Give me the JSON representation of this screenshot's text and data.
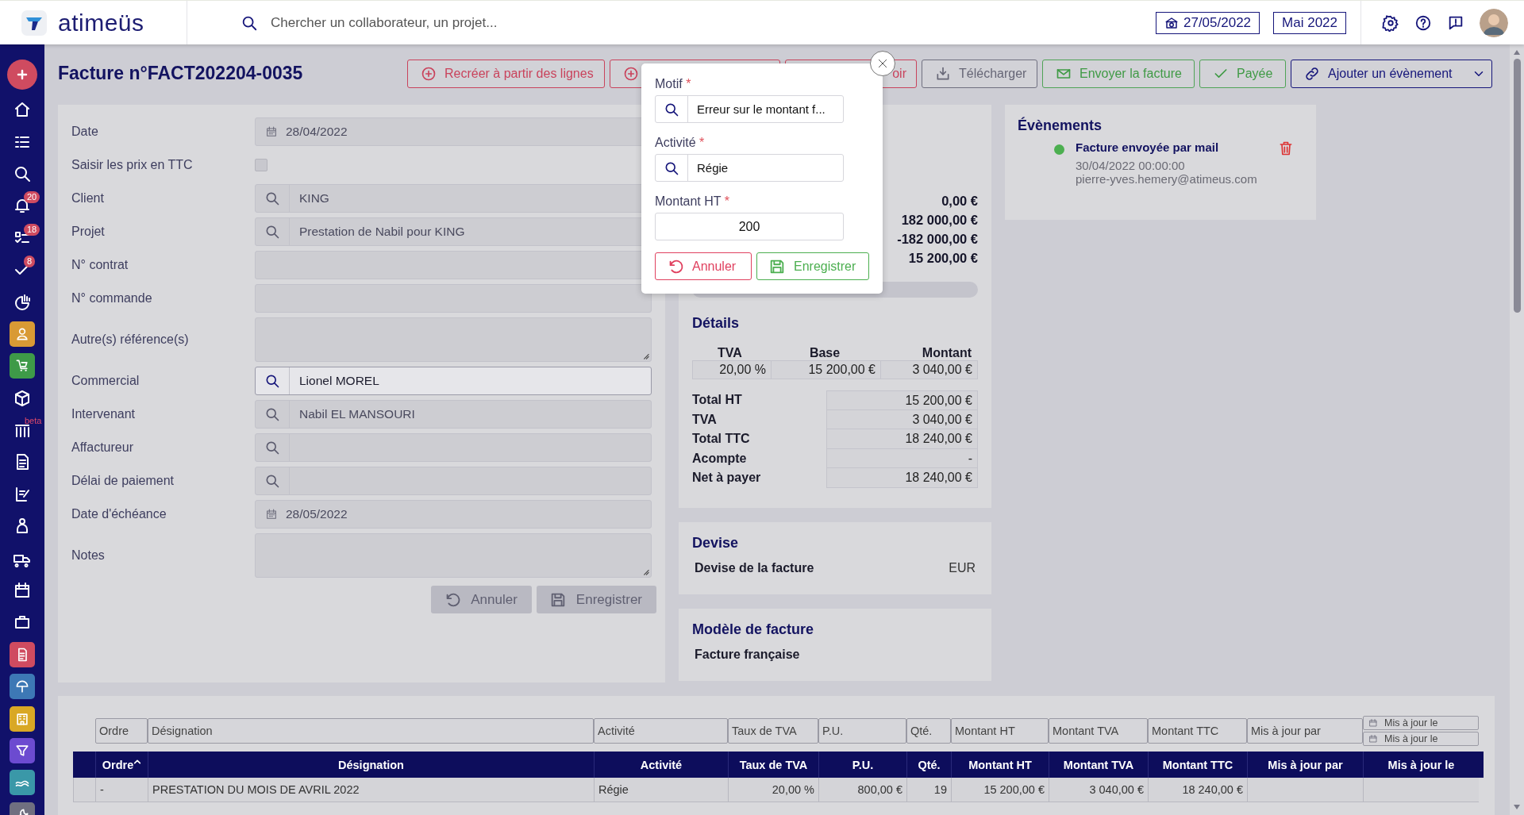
{
  "header": {
    "logo_text": "atimeüs",
    "search": {
      "placeholder": "Chercher un collaborateur, un projet..."
    },
    "date_button": "27/05/2022",
    "period_button": "Mai 2022"
  },
  "sidebar": {
    "items": [
      {
        "kind": "add"
      },
      {
        "kind": "plain"
      },
      {
        "kind": "plain"
      },
      {
        "kind": "plain"
      },
      {
        "kind": "plain",
        "badge": "20"
      },
      {
        "kind": "plain",
        "badge": "18"
      },
      {
        "kind": "plain",
        "badge": "8"
      },
      {
        "kind": "plain"
      },
      {
        "kind": "tile",
        "color": "#d99a35"
      },
      {
        "kind": "tile",
        "color": "#3e9a48"
      },
      {
        "kind": "plain"
      },
      {
        "kind": "plain",
        "tag": "beta"
      },
      {
        "kind": "plain"
      },
      {
        "kind": "plain"
      },
      {
        "kind": "plain"
      },
      {
        "kind": "plain"
      },
      {
        "kind": "plain"
      },
      {
        "kind": "plain"
      },
      {
        "kind": "tile",
        "color": "#cf4b60"
      },
      {
        "kind": "tile",
        "color": "#3d78b5"
      },
      {
        "kind": "tile",
        "color": "#d9a825"
      },
      {
        "kind": "tile",
        "color": "#6c4bd0"
      },
      {
        "kind": "tile",
        "color": "#3a98a8"
      },
      {
        "kind": "tile",
        "color": "#6f6f80"
      }
    ]
  },
  "page": {
    "title": "Facture n°FACT202204-0035"
  },
  "toolbar": [
    {
      "label": "Recréer à partir des lignes",
      "kind": "danger"
    },
    {
      "kind": "danger"
    },
    {
      "label": "oir",
      "kind": "danger"
    },
    {
      "label": "Télécharger",
      "kind": "neutral"
    },
    {
      "label": "Envoyer la facture",
      "kind": "success"
    },
    {
      "label": "Payée",
      "kind": "success"
    },
    {
      "label": "Ajouter un évènement",
      "kind": "primary"
    }
  ],
  "form": {
    "fields": [
      {
        "label": "Date",
        "kind": "date",
        "value": "28/04/2022",
        "disabled": true
      },
      {
        "label": "Saisir les prix en TTC",
        "kind": "checkbox",
        "checked": false,
        "disabled": true
      },
      {
        "label": "Client",
        "kind": "search",
        "value": "KING",
        "disabled": true
      },
      {
        "label": "Projet",
        "kind": "search",
        "value": "Prestation de Nabil pour KING",
        "disabled": true
      },
      {
        "label": "N° contrat",
        "kind": "text",
        "disabled": true
      },
      {
        "label": "N° commande",
        "kind": "text",
        "disabled": true
      },
      {
        "label": "Autre(s) référence(s)",
        "kind": "textarea",
        "disabled": true
      },
      {
        "label": "Commercial",
        "kind": "search",
        "value": "Lionel MOREL",
        "disabled": false
      },
      {
        "label": "Intervenant",
        "kind": "search",
        "value": "Nabil EL MANSOURI",
        "disabled": true
      },
      {
        "label": "Affactureur",
        "kind": "search",
        "disabled": true
      },
      {
        "label": "Délai de paiement",
        "kind": "search",
        "disabled": true
      },
      {
        "label": "Date d'échéance",
        "kind": "date",
        "value": "28/05/2022",
        "disabled": true
      },
      {
        "label": "Notes",
        "kind": "textarea",
        "disabled": true
      }
    ],
    "actions": [
      {
        "label": "Annuler",
        "kind": "cancel",
        "disabled": true
      },
      {
        "label": "Enregistrer",
        "kind": "save",
        "disabled": true
      }
    ]
  },
  "summary": {
    "amounts": [
      "0,00 €",
      "182 000,00 €",
      "-182 000,00 €",
      "15 200,00 €"
    ],
    "details": {
      "title": "Détails",
      "columns": [
        "TVA",
        "Base",
        "Montant"
      ],
      "rows": [
        [
          "20,00 %",
          "15 200,00 €",
          "3 040,00 €"
        ]
      ],
      "totals": [
        {
          "label": "Total HT",
          "value": "15 200,00 €"
        },
        {
          "label": "TVA",
          "value": "3 040,00 €"
        },
        {
          "label": "Total TTC",
          "value": "18 240,00 €"
        },
        {
          "label": "Acompte",
          "value": "-"
        },
        {
          "label": "Net à payer",
          "value": "18 240,00 €"
        }
      ]
    }
  },
  "currency": {
    "title": "Devise",
    "label": "Devise de la facture",
    "value": "EUR"
  },
  "template": {
    "title": "Modèle de facture",
    "value": "Facture française"
  },
  "events": {
    "title": "Évènements",
    "items": [
      {
        "title": "Facture envoyée par mail",
        "date": "30/04/2022 00:00:00",
        "author": "pierre-yves.hemery@atimeus.com",
        "color": "#4caf50"
      }
    ]
  },
  "popup": {
    "fields": [
      {
        "label": "Motif",
        "required_mark": "*",
        "kind": "search",
        "value": "Erreur sur le montant f..."
      },
      {
        "label": "Activité",
        "required_mark": "*",
        "kind": "search",
        "value": "Régie"
      },
      {
        "label": "Montant HT",
        "required_mark": "*",
        "kind": "number",
        "value": "200"
      }
    ],
    "actions": [
      {
        "label": "Annuler",
        "kind": "cancel"
      },
      {
        "label": "Enregistrer",
        "kind": "save"
      }
    ]
  },
  "lines_table": {
    "filters": [
      {
        "kind": "text",
        "placeholder": "Ordre"
      },
      {
        "kind": "text",
        "placeholder": "Désignation"
      },
      {
        "kind": "text",
        "placeholder": "Activité"
      },
      {
        "kind": "text",
        "placeholder": "Taux de TVA"
      },
      {
        "kind": "text",
        "placeholder": "P.U."
      },
      {
        "kind": "text",
        "placeholder": "Qté."
      },
      {
        "kind": "text",
        "placeholder": "Montant HT"
      },
      {
        "kind": "text",
        "placeholder": "Montant TVA"
      },
      {
        "kind": "text",
        "placeholder": "Montant TTC"
      },
      {
        "kind": "text",
        "placeholder": "Mis à jour par"
      },
      {
        "kind": "date_range",
        "placeholders": [
          "Mis à jour le",
          "Mis à jour le"
        ]
      }
    ],
    "columns": [
      {
        "label": "Ordre",
        "sorted": true
      },
      {
        "label": "Désignation",
        "sorted": false
      },
      {
        "label": "Activité",
        "sorted": false
      },
      {
        "label": "Taux de TVA",
        "sorted": false
      },
      {
        "label": "P.U.",
        "sorted": false
      },
      {
        "label": "Qté.",
        "sorted": false
      },
      {
        "label": "Montant HT",
        "sorted": false
      },
      {
        "label": "Montant TVA",
        "sorted": false
      },
      {
        "label": "Montant TTC",
        "sorted": false
      },
      {
        "label": "Mis à jour par",
        "sorted": false
      },
      {
        "label": "Mis à jour le",
        "sorted": false
      }
    ],
    "rows": [
      {
        "cells": [
          "-",
          "PRESTATION DU MOIS DE AVRIL 2022",
          "Régie",
          "20,00 %",
          "800,00 €",
          "19",
          "15 200,00 €",
          "3 040,00 €",
          "18 240,00 €"
        ]
      }
    ]
  }
}
